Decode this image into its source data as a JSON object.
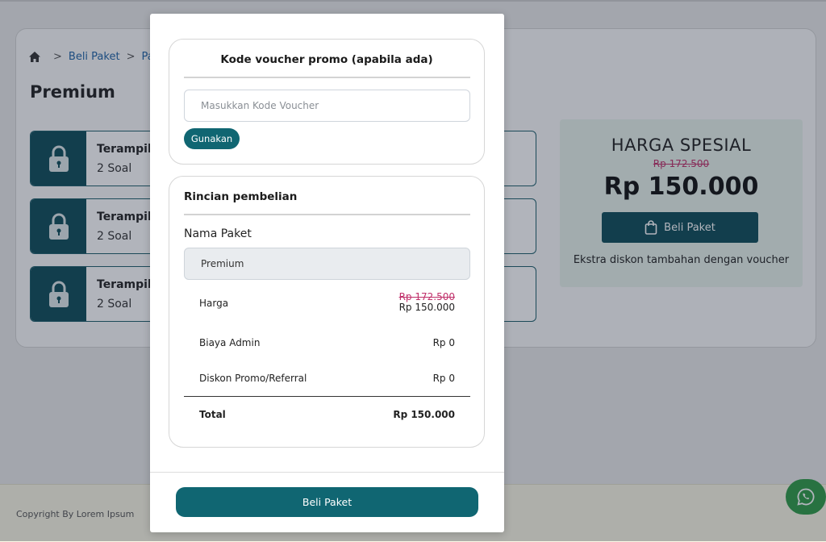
{
  "breadcrumb": {
    "items": [
      "Beli Paket",
      "Paket C"
    ]
  },
  "page": {
    "title": "Premium"
  },
  "items": [
    {
      "name": "Terampil E",
      "count": "2 Soal"
    },
    {
      "name": "Terampil E",
      "count": "2 Soal"
    },
    {
      "name": "Terampil E",
      "count": "2 Soal"
    }
  ],
  "promo": {
    "title": "HARGA SPESIAL",
    "old_price": "Rp 172.500",
    "new_price": "Rp 150.000",
    "button_label": "Beli Paket",
    "note": "Ekstra diskon tambahan dengan voucher"
  },
  "footer": {
    "copyright": "Copyright By Lorem Ipsum"
  },
  "modal": {
    "voucher": {
      "title": "Kode voucher promo (apabila ada)",
      "placeholder": "Masukkan Kode Voucher",
      "value": "",
      "button_label": "Gunakan"
    },
    "details": {
      "title": "Rincian pembelian",
      "package_label": "Nama Paket",
      "package_value": "Premium",
      "rows": {
        "harga": {
          "label": "Harga",
          "old_value": "Rp 172.500",
          "value": "Rp 150.000"
        },
        "admin": {
          "label": "Biaya Admin",
          "value": "Rp 0"
        },
        "diskon": {
          "label": "Diskon Promo/Referral",
          "value": "Rp 0"
        },
        "total": {
          "label": "Total",
          "value": "Rp 150.000"
        }
      }
    },
    "buy_button_label": "Beli Paket"
  },
  "colors": {
    "primary": "#106672",
    "dark_teal": "#0f4d59",
    "strike_pink": "#c0306a",
    "promo_bg": "#e9f3ec",
    "whatsapp": "#2f9c47"
  },
  "icons": [
    "home-icon",
    "lock-icon",
    "shopping-bag-icon",
    "whatsapp-icon"
  ]
}
